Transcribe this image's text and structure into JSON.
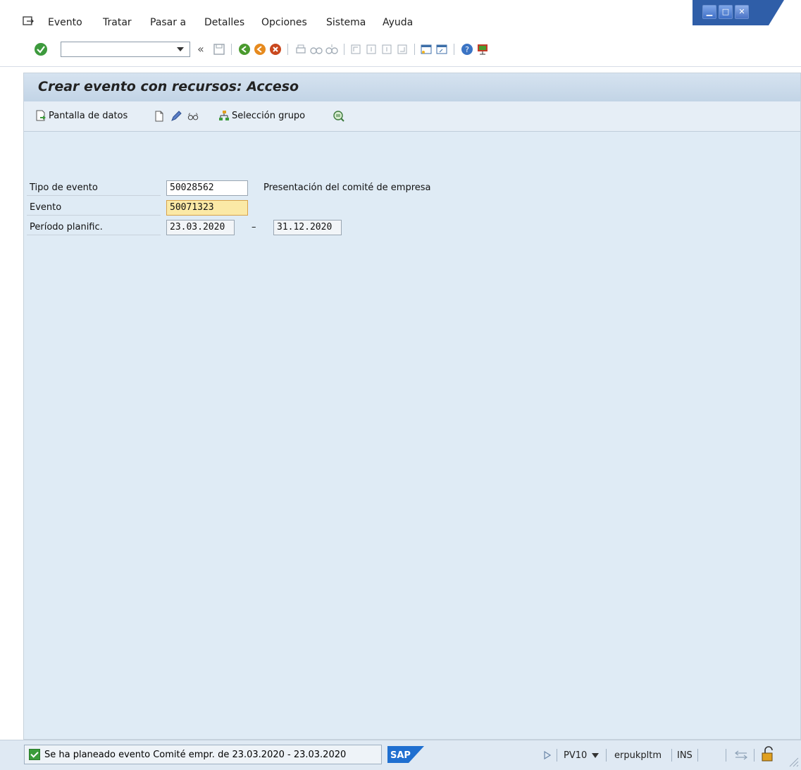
{
  "menubar": {
    "items": [
      "Evento",
      "Tratar",
      "Pasar a",
      "Detalles",
      "Opciones",
      "Sistema",
      "Ayuda"
    ]
  },
  "toolbar": {
    "command_value": "",
    "back_glyph": "«"
  },
  "screen": {
    "title": "Crear evento con recursos: Acceso",
    "buttons": {
      "data_screen": "Pantalla de datos",
      "group_selection": "Selección grupo"
    }
  },
  "form": {
    "event_type_label": "Tipo de evento",
    "event_type_value": "50028562",
    "event_type_desc": "Presentación del comité de empresa",
    "event_label": "Evento",
    "event_value": "50071323",
    "period_label": "Período planific.",
    "period_from": "23.03.2020",
    "period_sep": "–",
    "period_to": "31.12.2020"
  },
  "status": {
    "message": "Se ha planeado evento Comité empr. de 23.03.2020 - 23.03.2020",
    "logo": "SAP",
    "system": "PV10",
    "server": "erpukpltm",
    "mode": "INS"
  },
  "colors": {
    "frame_bg": "#dfebf5",
    "focused_field": "#fbe9a6",
    "status_ok": "#3a9c3a"
  }
}
